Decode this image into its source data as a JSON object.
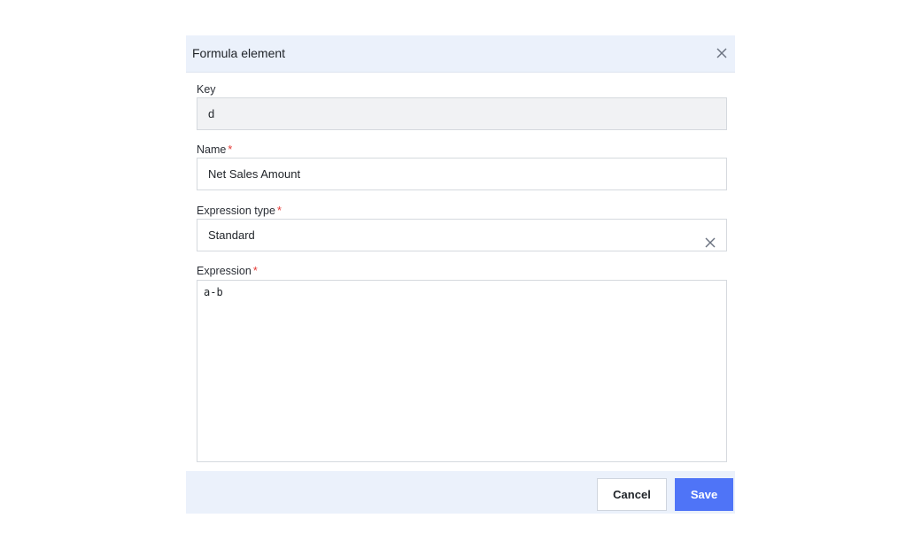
{
  "dialog": {
    "title": "Formula element",
    "close_icon": "close-icon"
  },
  "fields": {
    "key": {
      "label": "Key",
      "value": "d"
    },
    "name": {
      "label": "Name",
      "required_marker": "*",
      "value": "Net Sales Amount"
    },
    "expression_type": {
      "label": "Expression type",
      "required_marker": "*",
      "value": "Standard",
      "clear_icon": "clear-icon"
    },
    "expression": {
      "label": "Expression",
      "required_marker": "*",
      "value": "a-b"
    }
  },
  "footer": {
    "cancel_label": "Cancel",
    "save_label": "Save"
  },
  "colors": {
    "header_bg": "#ebf1fb",
    "primary": "#4f74f7",
    "required": "#e53935"
  }
}
